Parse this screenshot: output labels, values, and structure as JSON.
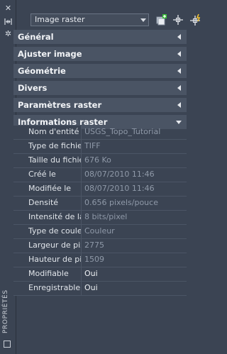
{
  "palette": {
    "title": "PROPRIÉTÉS"
  },
  "toolbar": {
    "selected_object": "Image raster"
  },
  "sections": [
    {
      "label": "Général",
      "state": "collapsed"
    },
    {
      "label": "Ajuster image",
      "state": "collapsed"
    },
    {
      "label": "Géométrie",
      "state": "collapsed"
    },
    {
      "label": "Divers",
      "state": "collapsed"
    },
    {
      "label": "Paramètres raster",
      "state": "collapsed"
    },
    {
      "label": "Informations raster",
      "state": "expanded"
    }
  ],
  "raster_info": [
    {
      "key": "Nom d'entité",
      "value": "USGS_Topo_Tutorial"
    },
    {
      "key": "Type de fichier",
      "value": "TIFF"
    },
    {
      "key": "Taille du fichier",
      "value": "676 Ko"
    },
    {
      "key": "Créé le",
      "value": "08/07/2010 11:46"
    },
    {
      "key": "Modifiée le",
      "value": "08/07/2010 11:46"
    },
    {
      "key": "Densité",
      "value": "0.656 pixels/pouce"
    },
    {
      "key": "Intensité de la...",
      "value": "8 bits/pixel"
    },
    {
      "key": "Type de couleur",
      "value": "Couleur"
    },
    {
      "key": "Largeur de pixel",
      "value": "2775"
    },
    {
      "key": "Hauteur de pixel",
      "value": "1509"
    },
    {
      "key": "Modifiable",
      "value": "Oui"
    },
    {
      "key": "Enregistrable",
      "value": "Oui"
    }
  ]
}
